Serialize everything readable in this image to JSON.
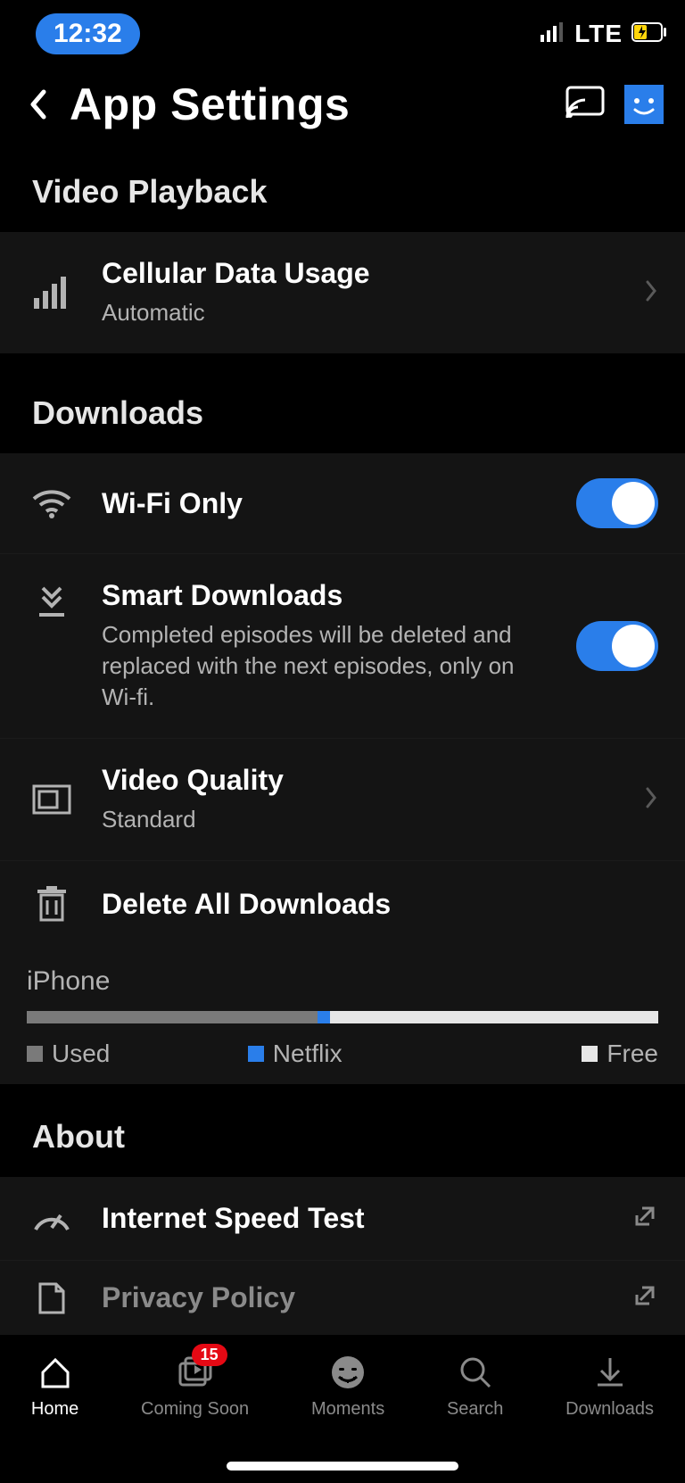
{
  "status": {
    "time": "12:32",
    "network_label": "LTE"
  },
  "header": {
    "title": "App Settings"
  },
  "sections": {
    "playback": {
      "title": "Video Playback",
      "cellular": {
        "title": "Cellular Data Usage",
        "value": "Automatic"
      }
    },
    "downloads": {
      "title": "Downloads",
      "wifi": {
        "title": "Wi-Fi Only",
        "on": true
      },
      "smart": {
        "title": "Smart Downloads",
        "desc": "Completed episodes will be deleted and replaced with the next episodes, only on Wi-fi.",
        "on": true
      },
      "quality": {
        "title": "Video Quality",
        "value": "Standard"
      },
      "deleteAll": {
        "title": "Delete All Downloads"
      },
      "storage": {
        "device": "iPhone",
        "legend": {
          "used": "Used",
          "nfx": "Netflix",
          "free": "Free"
        },
        "bar": {
          "used_pct": 46,
          "nfx_pct": 2,
          "free_pct": 52
        }
      }
    },
    "about": {
      "title": "About",
      "speed": {
        "title": "Internet Speed Test"
      },
      "privacy": {
        "title": "Privacy Policy"
      }
    }
  },
  "nav": {
    "home": "Home",
    "coming": "Coming Soon",
    "coming_badge": "15",
    "moments": "Moments",
    "search": "Search",
    "downloads": "Downloads"
  }
}
